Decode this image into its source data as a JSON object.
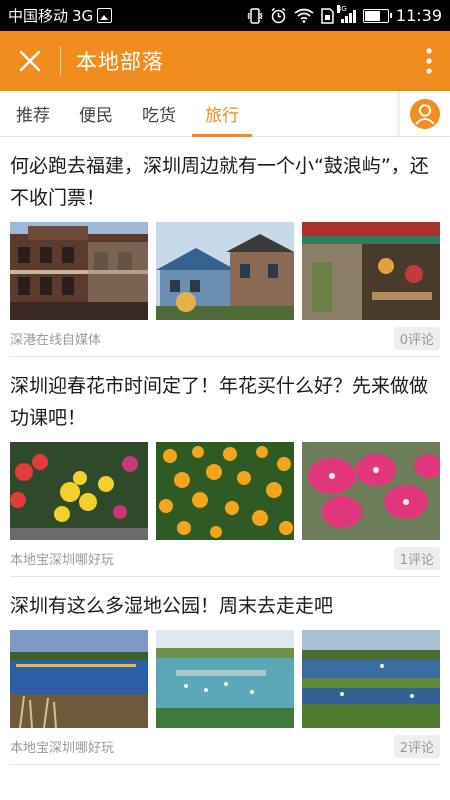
{
  "status_bar": {
    "carrier": "中国移动",
    "network": "3G",
    "signal_tag": "3G",
    "time": "11:39",
    "battery_level": 0.62
  },
  "header": {
    "title": "本地部落",
    "close_icon": "close-icon",
    "more_icon": "more-vertical-icon",
    "accent_color": "#f18c1e"
  },
  "tabs": [
    {
      "label": "推荐",
      "active": false
    },
    {
      "label": "便民",
      "active": false
    },
    {
      "label": "吃货",
      "active": false
    },
    {
      "label": "旅行",
      "active": true
    }
  ],
  "articles": [
    {
      "title": "何必跑去福建，深圳周边就有一个小“鼓浪屿”，还不收门票！",
      "images": [
        "old-colonial-building",
        "blue-roof-houses",
        "colorful-shop-front"
      ],
      "source": "深港在线自媒体",
      "comments": "0评论"
    },
    {
      "title": "深圳迎春花市时间定了！年花买什么好？先来做做功课吧！",
      "images": [
        "flower-bouquet",
        "kumquat-tree",
        "pink-orchids"
      ],
      "source": "本地宝深圳哪好玩",
      "comments": "1评论"
    },
    {
      "title": "深圳有这么多湿地公园！周末去走走吧",
      "images": [
        "wetland-lake-boardwalk",
        "wetland-birds",
        "wetland-marsh"
      ],
      "source": "本地宝深圳哪好玩",
      "comments": "2评论"
    }
  ]
}
